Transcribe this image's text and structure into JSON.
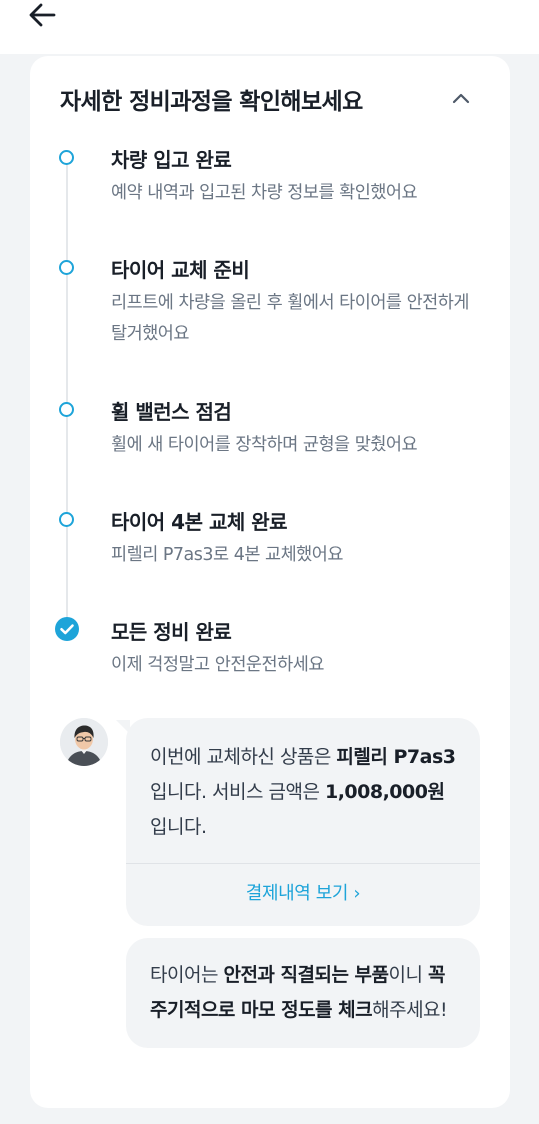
{
  "header": {
    "back_label": "뒤로가기"
  },
  "card": {
    "title": "자세한 정비과정을 확인해보세요",
    "collapse_label": "접기"
  },
  "steps": [
    {
      "title": "차량 입고 완료",
      "desc": "예약 내역과 입고된 차량 정보를 확인했어요",
      "status": "in-progress"
    },
    {
      "title": "타이어 교체 준비",
      "desc": "리프트에 차량을 올린 후 휠에서 타이어를 안전하게 탈거했어요",
      "status": "in-progress"
    },
    {
      "title": "휠 밸런스 점검",
      "desc": "휠에 새 타이어를 장착하며 균형을 맞췄어요",
      "status": "in-progress"
    },
    {
      "title": "타이어 4본 교체 완료",
      "desc": "피렐리 P7as3로 4본 교체했어요",
      "status": "in-progress"
    },
    {
      "title": "모든 정비 완료",
      "desc": "이제 걱정말고 안전운전하세요",
      "status": "done"
    }
  ],
  "message1": {
    "part1": "이번에 교체하신 상품은 ",
    "product": "피렐리 P7as3",
    "part2": " 입니다. 서비스 금액은 ",
    "price": "1,008,000원",
    "part3": " 입니다.",
    "link_label": "결제내역 보기 ›"
  },
  "message2": {
    "part1": "타이어는 ",
    "bold1": "안전과 직결되는 부품",
    "part2": "이니 ",
    "bold2": "꼭 주기적으로 마모 정도를 체크",
    "part3": "해주세요!"
  },
  "colors": {
    "accent": "#1ea4d9",
    "background": "#f2f4f6",
    "card": "#ffffff",
    "title_text": "#191f28",
    "secondary_text": "#6b7684"
  },
  "icons": [
    "back-arrow-icon",
    "chevron-up-icon",
    "check-circle-icon",
    "avatar-photo"
  ]
}
